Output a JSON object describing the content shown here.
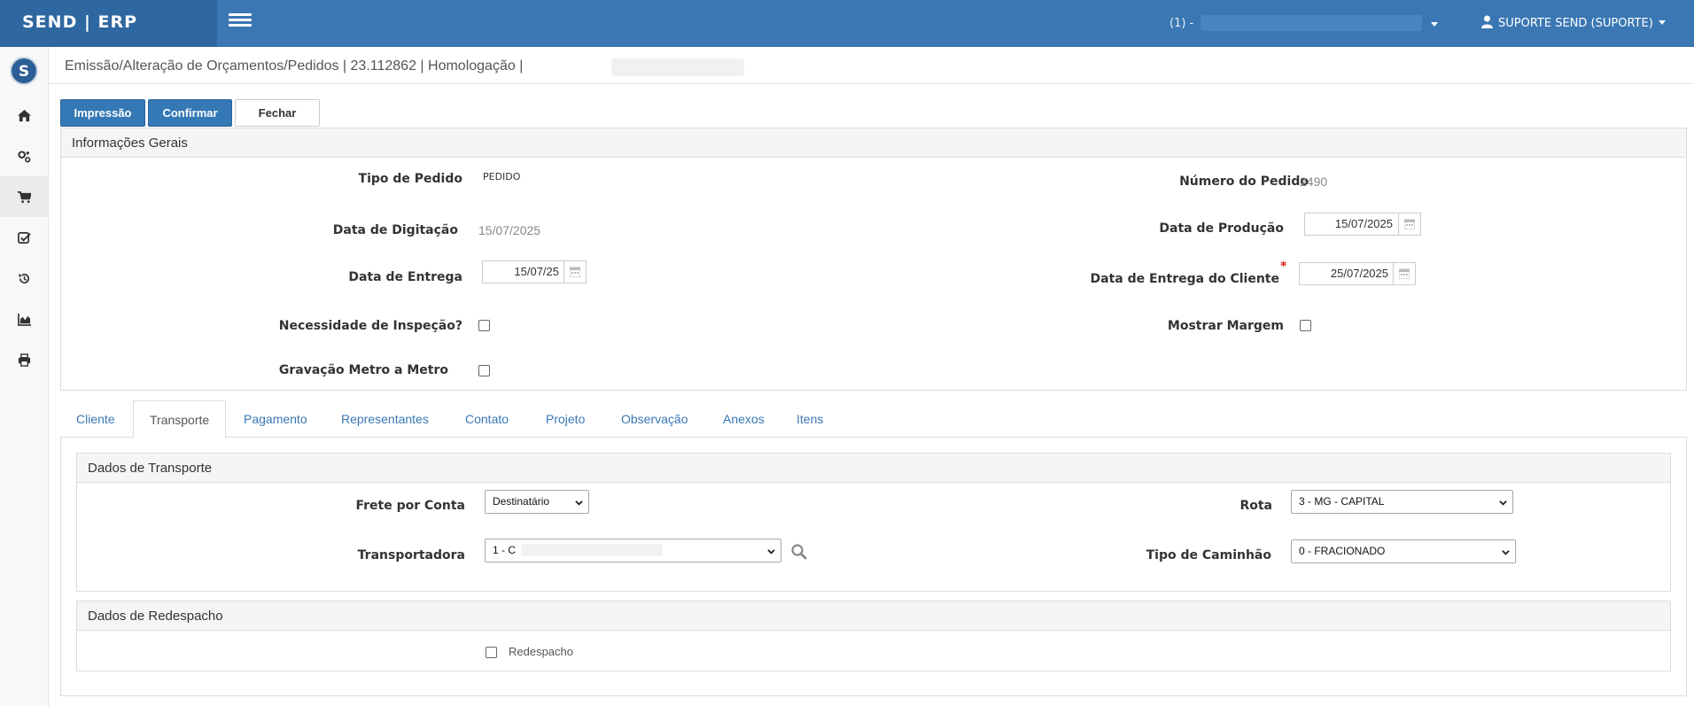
{
  "brand": "SEND | ERP",
  "topbar": {
    "company_label": "(1) -",
    "user_label": "SUPORTE SEND (SUPORTE)"
  },
  "sidebar": {
    "logo_letter": "S",
    "items": [
      {
        "icon": "home-icon"
      },
      {
        "icon": "gears-icon"
      },
      {
        "icon": "cart-icon"
      },
      {
        "icon": "checklist-icon"
      },
      {
        "icon": "history-icon"
      },
      {
        "icon": "chart-icon"
      },
      {
        "icon": "print-icon"
      }
    ]
  },
  "header": {
    "title": "Emissão/Alteração de Orçamentos/Pedidos | 23.112862 | Homologação |"
  },
  "toolbar": {
    "print_label": "Impressão",
    "confirm_label": "Confirmar",
    "close_label": "Fechar"
  },
  "general_info": {
    "heading": "Informações Gerais",
    "order_type_label": "Tipo de Pedido",
    "order_type_value": "PEDIDO",
    "order_number_label": "Número do Pedido",
    "order_number_value": "2490",
    "entry_date_label": "Data de Digitação",
    "entry_date_value": "15/07/2025",
    "production_date_label": "Data de Produção",
    "production_date_value": "15/07/2025",
    "delivery_date_label": "Data de Entrega",
    "delivery_date_value": "15/07/25",
    "client_delivery_date_label": "Data de Entrega do Cliente",
    "client_delivery_date_value": "25/07/2025",
    "required_mark": "*",
    "inspection_label": "Necessidade de Inspeção?",
    "show_margin_label": "Mostrar Margem",
    "meter_recording_label": "Gravação Metro a Metro"
  },
  "tabs": [
    {
      "label": "Cliente"
    },
    {
      "label": "Transporte"
    },
    {
      "label": "Pagamento"
    },
    {
      "label": "Representantes"
    },
    {
      "label": "Contato"
    },
    {
      "label": "Projeto"
    },
    {
      "label": "Observação"
    },
    {
      "label": "Anexos"
    },
    {
      "label": "Itens"
    }
  ],
  "active_tab": "Transporte",
  "transport": {
    "heading": "Dados de Transporte",
    "freight_label": "Frete por Conta",
    "freight_value": "Destinatário",
    "route_label": "Rota",
    "route_value": "3 - MG - CAPITAL",
    "carrier_label": "Transportadora",
    "carrier_value": "1 - C",
    "truck_type_label": "Tipo de Caminhão",
    "truck_type_value": "0 - FRACIONADO"
  },
  "redispatch": {
    "heading": "Dados de Redespacho",
    "checkbox_label": "Redespacho"
  },
  "colors": {
    "topbar": "#3a77b3",
    "brand_bg": "#2f67a0",
    "primary_button": "#3478b5",
    "tab_link": "#3a78b5",
    "required": "#d9251d"
  }
}
